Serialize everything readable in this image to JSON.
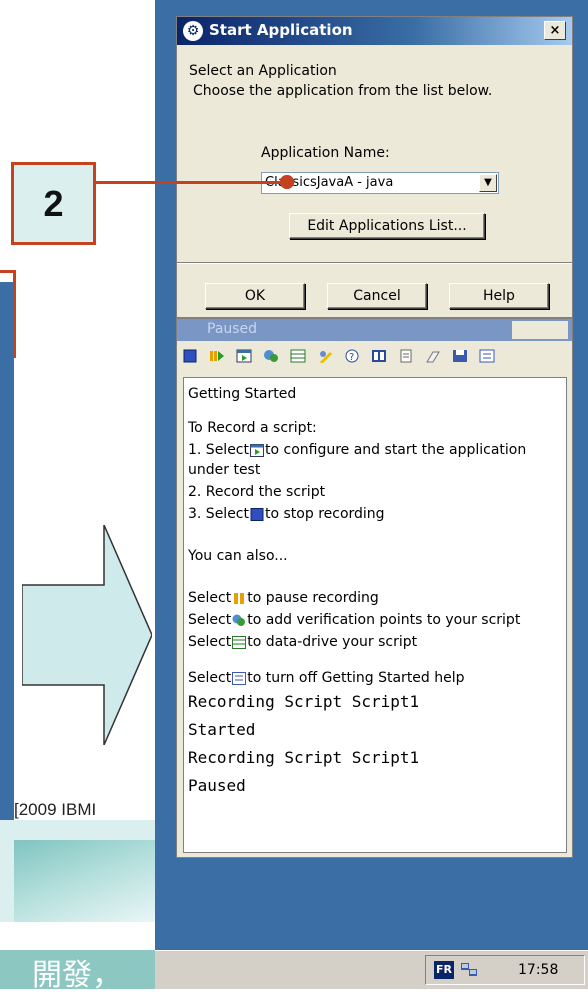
{
  "callout": {
    "number": "2"
  },
  "slide": {
    "bottom_text": "[2009 IBMI",
    "taskbar_chars": "開發，"
  },
  "dialog": {
    "title": "Start Application",
    "close_label": "×",
    "heading": "Select an Application",
    "subheading": "Choose the application from the list below.",
    "app_name_label": "Application Name:",
    "selected_app": "ClassicsJavaA - java",
    "edit_list_button": "Edit Applications List...",
    "ok_button": "OK",
    "cancel_button": "Cancel",
    "help_button": "Help"
  },
  "paused_window": {
    "title": "Paused",
    "toolbar_icons": [
      "stop-recording-icon",
      "pause-icon",
      "start-application-icon",
      "verification-point-icon",
      "data-driver-icon",
      "script-support-icon",
      "help-icon",
      "display-icon",
      "notes-icon",
      "clear-icon",
      "save-icon",
      "getting-started-icon"
    ],
    "lines": {
      "getting_started": "Getting Started",
      "to_record": "To Record a script:",
      "step1a_pre": "1. Select",
      "step1a_post": "to configure and start the application",
      "step1b": "under test",
      "step2": "2. Record the script",
      "step3_pre": "3. Select",
      "step3_post": "to stop recording",
      "also": "You can also...",
      "pause_pre": "Select",
      "pause_post": "to pause recording",
      "vp_pre": "Select",
      "vp_post": "to add verification points to your script",
      "dd_pre": "Select",
      "dd_post": "to data-drive your script",
      "gs_pre": "Select",
      "gs_post": "to turn off Getting Started help",
      "log1": "Recording Script Script1",
      "log2": "Started",
      "log3": "Recording Script Script1",
      "log4": "Paused"
    }
  },
  "taskbar": {
    "lang": "FR",
    "clock": "17:58"
  },
  "colors": {
    "desktop": "#3a6ea5",
    "callout_border": "#c4421f",
    "arrow_fill": "#cfeaea"
  }
}
